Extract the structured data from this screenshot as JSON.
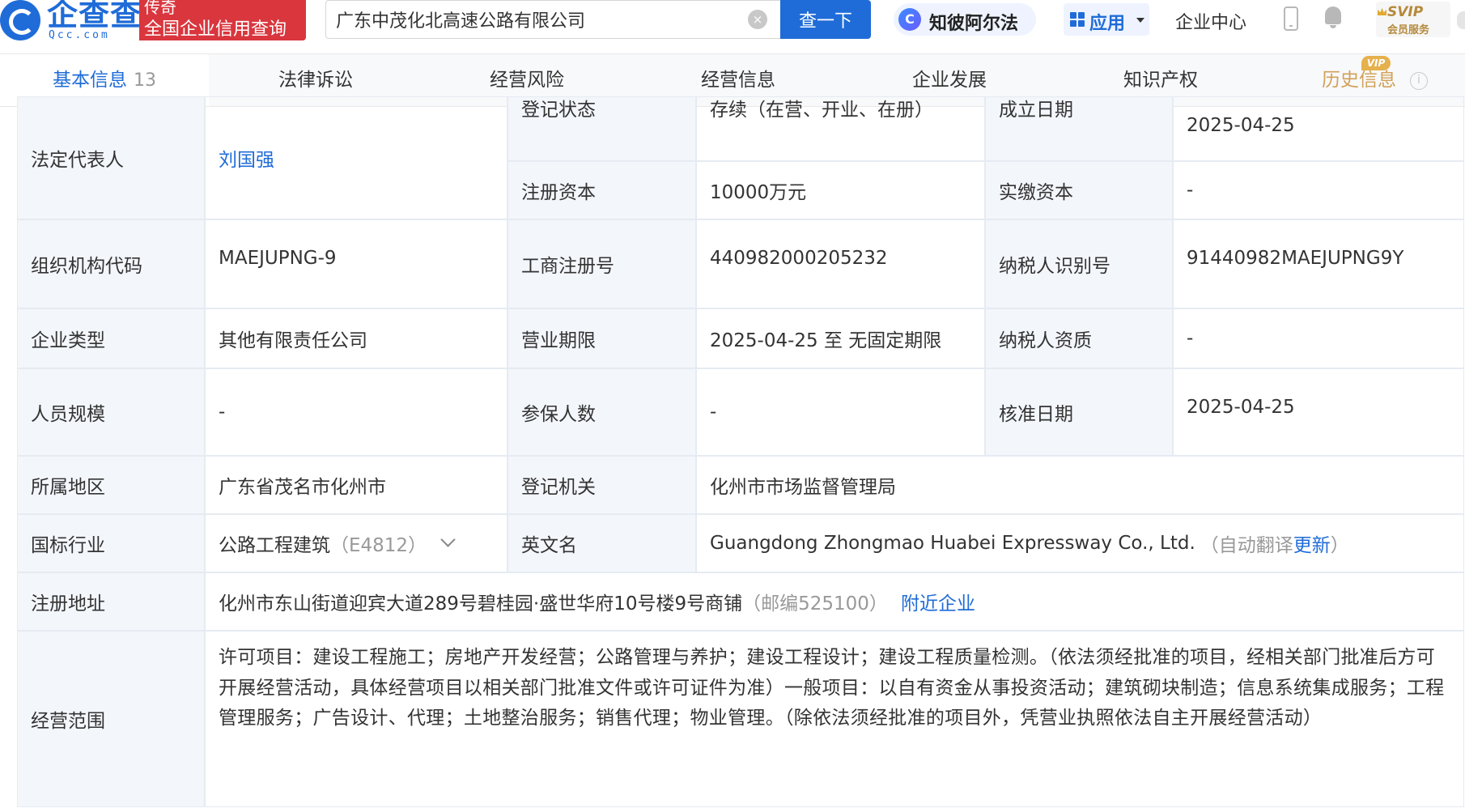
{
  "header": {
    "logo_name": "企查查",
    "logo_sub": "Qcc.com",
    "promo_line1": "传奇",
    "promo_line2": "全国企业信用查询",
    "search_value": "广东中茂化北高速公路有限公司",
    "search_button": "查一下",
    "zhibi_icon_letter": "C",
    "zhibi_label": "知彼阿尔法",
    "apps_label": "应用",
    "enterprise_center": "企业中心",
    "svip_top": "SVIP",
    "svip_bottom": "会员服务"
  },
  "tabs": [
    {
      "label": "基本信息",
      "count": "13"
    },
    {
      "label": "法律诉讼"
    },
    {
      "label": "经营风险"
    },
    {
      "label": "经营信息"
    },
    {
      "label": "企业发展"
    },
    {
      "label": "知识产权"
    },
    {
      "label": "历史信息",
      "badge": "VIP"
    }
  ],
  "info": {
    "legal_rep_label": "法定代表人",
    "legal_rep_value": "刘国强",
    "reg_status_label": "登记状态",
    "reg_status_value": "存续（在营、开业、在册）",
    "found_date_label": "成立日期",
    "found_date_value": "2025-04-25",
    "reg_capital_label": "注册资本",
    "reg_capital_value": "10000万元",
    "paid_capital_label": "实缴资本",
    "paid_capital_value": "-",
    "org_code_label": "组织机构代码",
    "org_code_value": "MAEJUPNG-9",
    "biz_reg_no_label": "工商注册号",
    "biz_reg_no_value": "440982000205232",
    "taxpayer_id_label": "纳税人识别号",
    "taxpayer_id_value": "91440982MAEJUPNG9Y",
    "company_type_label": "企业类型",
    "company_type_value": "其他有限责任公司",
    "biz_term_label": "营业期限",
    "biz_term_value": "2025-04-25 至 无固定期限",
    "taxpayer_qual_label": "纳税人资质",
    "taxpayer_qual_value": "-",
    "staff_size_label": "人员规模",
    "staff_size_value": "-",
    "insured_label": "参保人数",
    "insured_value": "-",
    "approve_date_label": "核准日期",
    "approve_date_value": "2025-04-25",
    "region_label": "所属地区",
    "region_value": "广东省茂名市化州市",
    "reg_authority_label": "登记机关",
    "reg_authority_value": "化州市市场监督管理局",
    "industry_label": "国标行业",
    "industry_value": "公路工程建筑",
    "industry_code": "（E4812）",
    "english_name_label": "英文名",
    "english_name_value": "Guangdong Zhongmao Huabei Expressway Co., Ltd.",
    "auto_translate_prefix": "（自动翻译",
    "auto_translate_link": "更新",
    "auto_translate_suffix": "）",
    "address_label": "注册地址",
    "address_value": "化州市东山街道迎宾大道289号碧桂园·盛世华府10号楼9号商铺",
    "postcode": "（邮编525100）",
    "nearby_link": "附近企业",
    "scope_label": "经营范围",
    "scope_value": "许可项目：建设工程施工；房地产开发经营；公路管理与养护；建设工程设计；建设工程质量检测。（依法须经批准的项目，经相关部门批准后方可开展经营活动，具体经营项目以相关部门批准文件或许可证件为准）一般项目：以自有资金从事投资活动；建筑砌块制造；信息系统集成服务；工程管理服务；广告设计、代理；土地整治服务；销售代理；物业管理。（除依法须经批准的项目外，凭营业执照依法自主开展经营活动）"
  }
}
